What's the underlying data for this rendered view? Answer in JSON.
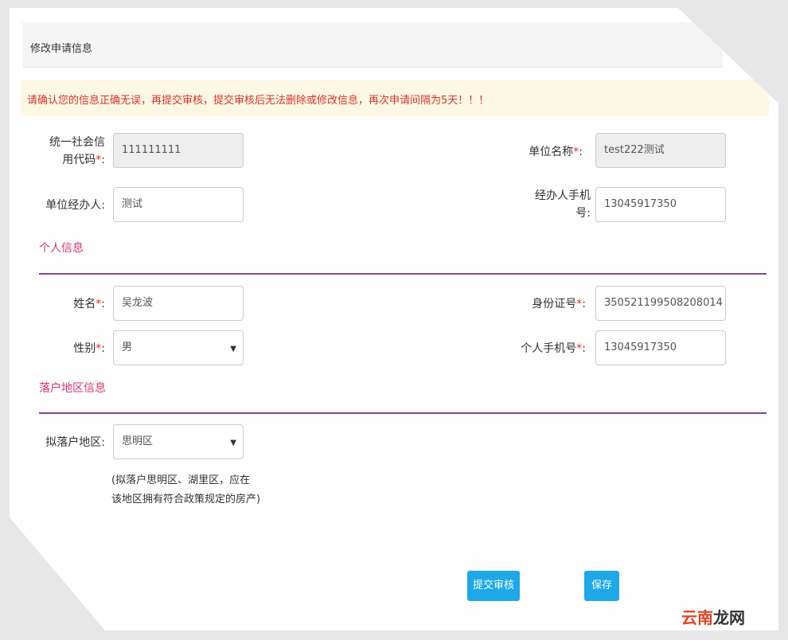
{
  "header": {
    "title": "修改申请信息"
  },
  "alert": {
    "text": "请确认您的信息正确无误，再提交审核，提交审核后无法删除或修改信息，再次申请间隔为5天！！！"
  },
  "org": {
    "credit_code": {
      "label_line1": "统一社会信",
      "label_line2": "用代码",
      "required": "*",
      "colon": ":",
      "value": "111111111"
    },
    "unit_name": {
      "label": "单位名称",
      "required": "*",
      "colon": ":",
      "value": "test222测试"
    },
    "agent": {
      "label": "单位经办人",
      "colon": ":",
      "value": "测试"
    },
    "agent_phone": {
      "label_line1": "经办人手机",
      "label_line2": "号",
      "colon": ":",
      "value": "13045917350"
    }
  },
  "personal": {
    "section_title": "个人信息",
    "name": {
      "label": "姓名",
      "required": "*",
      "colon": ":",
      "value": "吴龙波"
    },
    "id_number": {
      "label": "身份证号",
      "required": "*",
      "colon": ":",
      "value": "350521199508208014"
    },
    "gender": {
      "label": "性别",
      "required": "*",
      "colon": ":",
      "value": "男"
    },
    "phone": {
      "label": "个人手机号",
      "required": "*",
      "colon": ":",
      "value": "13045917350"
    }
  },
  "settle": {
    "section_title": "落户地区信息",
    "region": {
      "label": "拟落户地区",
      "colon": ":",
      "value": "思明区"
    },
    "note_line1": "(拟落户思明区、湖里区，应在",
    "note_line2": "该地区拥有符合政策规定的房产)"
  },
  "actions": {
    "submit_label": "提交审核",
    "save_label": "保存"
  },
  "watermark": {
    "part1": "云南",
    "part2": "龙网"
  },
  "colors": {
    "accent": "#1ea8e8",
    "alert_text": "#d9342b",
    "section_title": "#d63674",
    "divider": "#7d4a8f",
    "alert_bg": "#fcf8e3"
  }
}
